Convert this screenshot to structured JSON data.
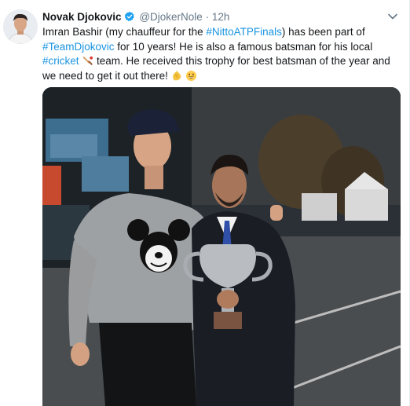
{
  "tweet": {
    "author_name": "Novak Djokovic",
    "author_handle": "@DjokerNole",
    "separator": "·",
    "timestamp": "12h",
    "text_part1": "Imran Bashir (my chauffeur for the ",
    "hashtag1": "#NittoATPFinals",
    "text_part2": ") has been part of ",
    "hashtag2": "#TeamDjokovic",
    "text_part3": " for 10 years! He is also a famous batsman for his local ",
    "hashtag3": "#cricket",
    "text_part4": " team. He received this trophy for best batsman of the year and we need to get it out there! ",
    "emojis": [
      "cricket-bat-emoji",
      "clapping-hands-emoji",
      "grinning-face-emoji"
    ]
  },
  "icons": {
    "verified": "verified-badge-icon",
    "menu": "chevron-down-icon"
  },
  "colors": {
    "link": "#1b95e0",
    "verified": "#1da1f2",
    "muted": "#657786"
  }
}
